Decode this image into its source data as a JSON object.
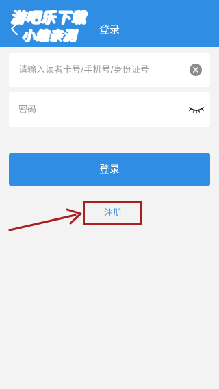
{
  "header": {
    "title": "登录",
    "back_icon": "chevron-left-icon"
  },
  "watermark": {
    "line1": "游吧乐下载",
    "line2": "小编亲测"
  },
  "form": {
    "account_placeholder": "请输入读者卡号/手机号/身份证号",
    "account_value": "",
    "password_placeholder": "密码",
    "password_value": "",
    "clear_icon": "clear-circle-icon",
    "eye_icon": "eye-closed-icon",
    "login_label": "登录",
    "register_label": "注册"
  },
  "colors": {
    "primary": "#2f8de4",
    "background": "#f3f3f3",
    "annotation": "#a91e23"
  }
}
